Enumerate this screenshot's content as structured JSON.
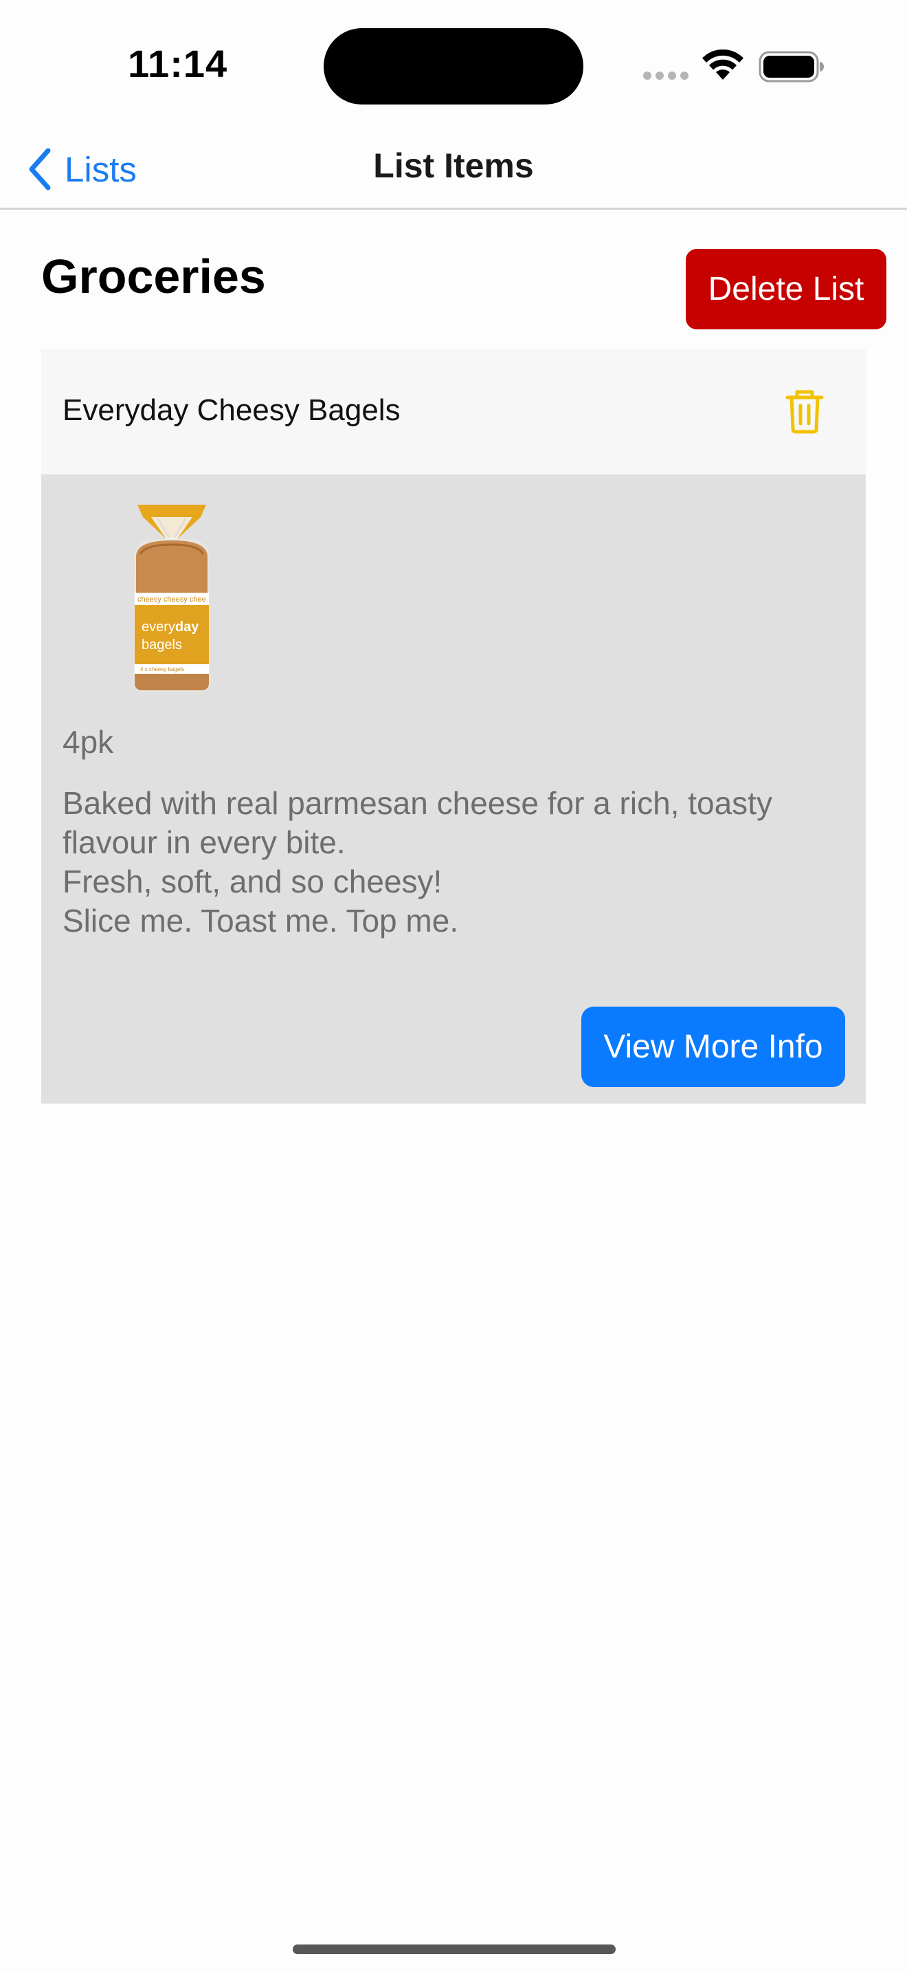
{
  "status_bar": {
    "time": "11:14"
  },
  "nav": {
    "back_label": "Lists",
    "title": "List Items"
  },
  "list": {
    "title": "Groceries",
    "delete_label": "Delete List"
  },
  "item": {
    "name": "Everyday Cheesy Bagels",
    "image_icon": "bagels-package-image",
    "quantity": "4pk",
    "description_lines": [
      "Baked with real parmesan cheese for a rich, toasty",
      "flavour in every bite.",
      "Fresh, soft, and so cheesy!",
      "Slice me. Toast me. Top me."
    ],
    "view_more_label": "View More Info",
    "package_text": {
      "band": "cheesy   cheesy   chee",
      "brand_light": "every",
      "brand_bold": "day",
      "product": "bagels",
      "small": "4 x cheesy bagels"
    }
  },
  "colors": {
    "accent": "#1a7cf2",
    "delete_button": "#c70000",
    "view_more_button": "#0a7aff",
    "trash_icon": "#f2c200",
    "item_header_bg": "#f7f7f7",
    "item_body_bg": "#e0e0e0"
  }
}
